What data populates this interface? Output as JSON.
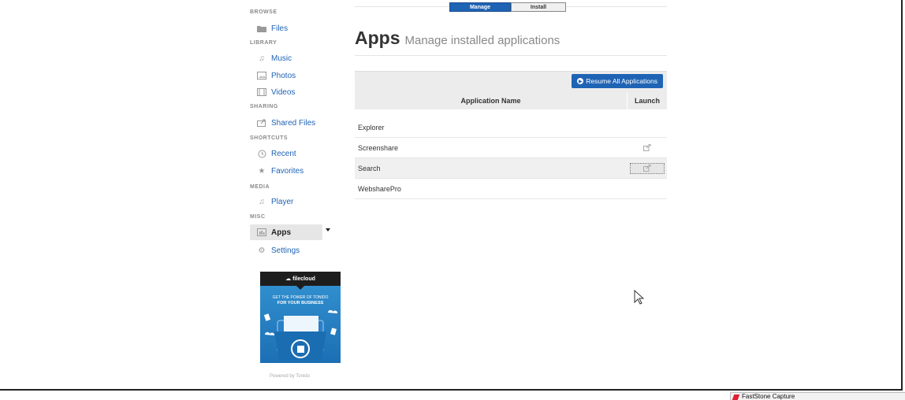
{
  "sidebar": {
    "sections": {
      "browse": "BROWSE",
      "library": "LIBRARY",
      "sharing": "SHARING",
      "shortcuts": "SHORTCUTS",
      "media": "MEDIA",
      "misc": "MISC"
    },
    "items": {
      "files": "Files",
      "music": "Music",
      "photos": "Photos",
      "videos": "Videos",
      "shared_files": "Shared Files",
      "recent": "Recent",
      "favorites": "Favorites",
      "player": "Player",
      "apps": "Apps",
      "settings": "Settings"
    },
    "active": "apps"
  },
  "ad": {
    "brand": "filecloud",
    "line1": "GET THE POWER OF TONIDO",
    "line2": "FOR YOUR BUSINESS"
  },
  "footer": {
    "powered": "Powered by Tonido"
  },
  "tabs": {
    "manage": "Manage",
    "install": "Install",
    "active": "manage"
  },
  "header": {
    "title": "Apps",
    "subtitle": "Manage installed applications"
  },
  "toolbar": {
    "resume_label": "Resume All Applications"
  },
  "table": {
    "columns": {
      "name": "Application Name",
      "launch": "Launch"
    },
    "rows": [
      {
        "name": "Explorer",
        "launch": false
      },
      {
        "name": "Screenshare",
        "launch": true
      },
      {
        "name": "Search",
        "launch": true,
        "focused": true
      },
      {
        "name": "WebsharePro",
        "launch": false
      }
    ]
  },
  "taskbar": {
    "item": "FastStone Capture"
  },
  "colors": {
    "accent": "#1f63b5",
    "link": "#1f63b5",
    "header_bg": "#ececec"
  }
}
